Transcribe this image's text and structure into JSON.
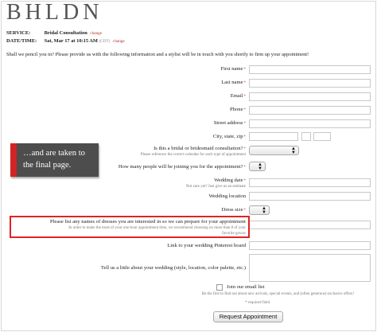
{
  "brand": {
    "logo_text": "BHLDN"
  },
  "appointment": {
    "service_label": "SERVICE:",
    "service_value": "Bridal Consultation",
    "datetime_label": "DATE/TIME:",
    "datetime_value": "Sat, Mar 17 at 10:15 AM",
    "timezone": "(CDT)",
    "change_label": "change"
  },
  "intro": "Shall we pencil you in? Please provide us with the following information and a stylist will be in touch with you shortly to firm up your appointment!",
  "form": {
    "required_marker": "*",
    "first_name": "First name",
    "last_name": "Last name",
    "email": "Email",
    "phone": "Phone",
    "street_address": "Street address",
    "city_state_zip": "City, state, zip",
    "bridal_question": "Is this a bridal or bridesmaid consultation?",
    "bridal_hint": "Please reference the correct calendar for each type of appointment",
    "people_question": "How many people will be joining you for the appointment?",
    "wedding_date": "Wedding date",
    "wedding_date_hint": "Not sure yet? Just give us an estimate",
    "wedding_location": "Wedding location",
    "dress_size": "Dress size",
    "dresses_label": "Please list any names of dresses you are interested in so we can prepare for your appointment",
    "dresses_hint_1": "In order to make the most of your one-hour appointment time, we recommend choosing no more than 8 of your",
    "dresses_hint_2": "favorite gowns",
    "pinterest": "Link to your wedding Pinterest board",
    "tell_us": "Tell us a little about your wedding (style, location, color palette, etc.)",
    "email_list": "Join our email list",
    "email_list_hint": "Be the first to find out about new arrivals, special events, and (often generous) exclusive offers!",
    "required_note": "* required field",
    "submit_label": "Request Appointment"
  },
  "banner": {
    "text": "…and are taken to the final page."
  },
  "colors": {
    "accent": "#b5332e",
    "banner_bg": "#4d4d4d",
    "banner_bar": "#d12424",
    "highlight": "#e02323"
  }
}
